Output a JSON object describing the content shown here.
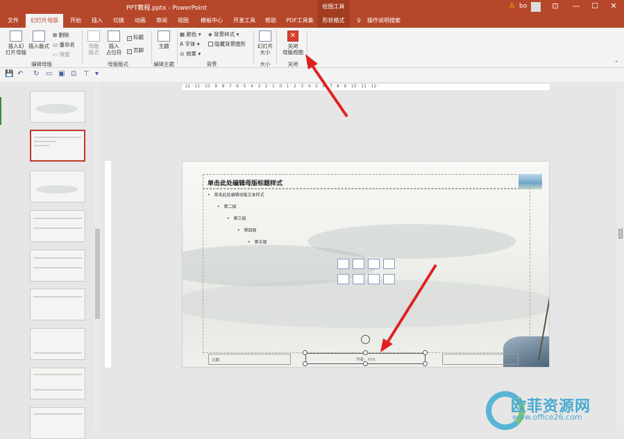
{
  "titlebar": {
    "title": "PPT教程.pptx  -  PowerPoint",
    "context_label": "绘图工具",
    "user_name": "bo",
    "controls": [
      "⊡",
      "—",
      "☐",
      "✕"
    ]
  },
  "tabs": [
    {
      "label": "文件"
    },
    {
      "label": "幻灯片母版"
    },
    {
      "label": "开始"
    },
    {
      "label": "插入"
    },
    {
      "label": "切换"
    },
    {
      "label": "动画"
    },
    {
      "label": "审阅"
    },
    {
      "label": "视图"
    },
    {
      "label": "模板中心"
    },
    {
      "label": "开发工具"
    },
    {
      "label": "帮助"
    },
    {
      "label": "PDF工具集"
    },
    {
      "label": "形状格式"
    },
    {
      "label": "操作说明搜索"
    }
  ],
  "ribbon": {
    "insert_master_1": "插入幻",
    "insert_master_2": "灯片母版",
    "insert_layout": "插入版式",
    "delete": "删除",
    "rename": "重命名",
    "preserve": "保留",
    "group_edit_master": "编辑母版",
    "master_layout_1": "母版",
    "master_layout_2": "版式",
    "insert_placeholder_1": "插入",
    "insert_placeholder_2": "占位符",
    "chk_title": "标题",
    "chk_footer": "页脚",
    "group_master_layout": "母版版式",
    "theme": "主题",
    "group_edit_theme": "编辑主题",
    "colors": "颜色",
    "fonts": "字体",
    "effects": "效果",
    "bg_styles": "背景样式",
    "hide_bg": "隐藏背景图形",
    "group_background": "背景",
    "slide_size_1": "幻灯片",
    "slide_size_2": "大小",
    "group_size": "大小",
    "close_1": "关闭",
    "close_2": "母版视图",
    "group_close": "关闭"
  },
  "slide": {
    "title_placeholder": "单击此处编辑母版标题样式",
    "levels": [
      "单击此处编辑母版文本样式",
      "第二级",
      "第三级",
      "第四级",
      "第五级"
    ],
    "footer_date": "日期",
    "footer_center": "作者：XXX"
  },
  "ruler": {
    "horizontal": "· 12 · 11 · 10 · 9 · 8 · 7 · 6 · 5 · 4 · 3 · 2 · 1 · 0 · 1 · 2 · 3 · 4 · 5 · 6 · 7 · 8 · 9 · 10 · 11 · 12 ·"
  },
  "watermark": {
    "text": "欧菲资源网",
    "url": "www.office26.com"
  },
  "colors": {
    "brand": "#b7472a",
    "arrow": "#e0201f"
  }
}
